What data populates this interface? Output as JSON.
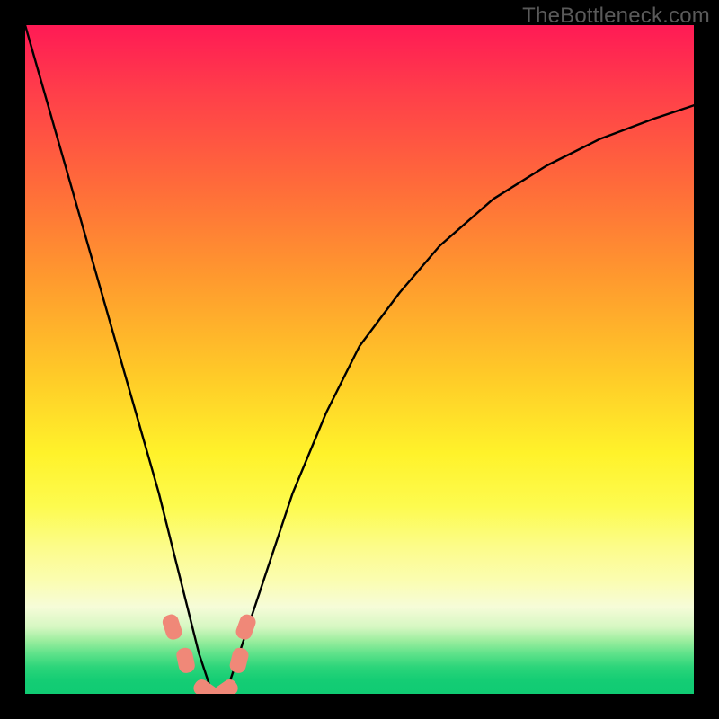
{
  "watermark": "TheBottleneck.com",
  "chart_data": {
    "type": "line",
    "title": "",
    "xlabel": "",
    "ylabel": "",
    "xlim": [
      0,
      100
    ],
    "ylim": [
      0,
      100
    ],
    "grid": false,
    "legend": false,
    "series": [
      {
        "name": "bottleneck-curve",
        "x": [
          0,
          4,
          8,
          12,
          16,
          20,
          24,
          26,
          28,
          30,
          32,
          36,
          40,
          45,
          50,
          56,
          62,
          70,
          78,
          86,
          94,
          100
        ],
        "y": [
          100,
          86,
          72,
          58,
          44,
          30,
          14,
          6,
          0,
          0,
          6,
          18,
          30,
          42,
          52,
          60,
          67,
          74,
          79,
          83,
          86,
          88
        ]
      }
    ],
    "markers": [
      {
        "name": "marker-left-upper",
        "x": 22,
        "y": 10
      },
      {
        "name": "marker-left-lower",
        "x": 24,
        "y": 5
      },
      {
        "name": "marker-trough-left",
        "x": 27,
        "y": 0.5
      },
      {
        "name": "marker-trough-right",
        "x": 30,
        "y": 0.5
      },
      {
        "name": "marker-right-lower",
        "x": 32,
        "y": 5
      },
      {
        "name": "marker-right-upper",
        "x": 33,
        "y": 10
      }
    ],
    "colors": {
      "curve": "#000000",
      "marker_fill": "#f08878",
      "marker_stroke": "#f08878"
    }
  }
}
